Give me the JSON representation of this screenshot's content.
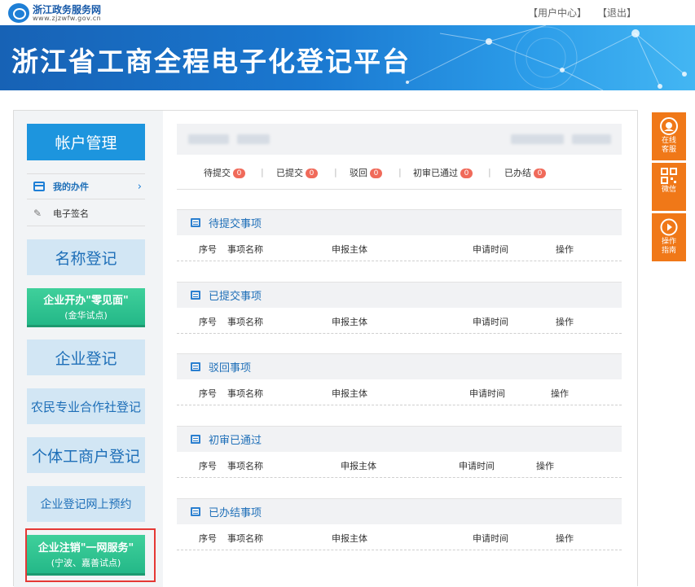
{
  "header": {
    "logo_cn": "浙江政务服务网",
    "logo_en": "www.zjzwfw.gov.cn",
    "user_center": "【用户中心】",
    "logout": "【退出】"
  },
  "banner": {
    "title": "浙江省工商全程电子化登记平台"
  },
  "sidebar": {
    "account_title": "帐户管理",
    "account_items": [
      {
        "label": "我的办件"
      },
      {
        "label": "电子签名"
      }
    ],
    "nav": [
      {
        "label": "名称登记"
      },
      {
        "line1": "企业开办\"零见面\"",
        "line2": "(金华试点)"
      },
      {
        "label": "企业登记"
      },
      {
        "label": "农民专业合作社登记"
      },
      {
        "label": "个体工商户登记"
      },
      {
        "label": "企业登记网上预约"
      },
      {
        "line1": "企业注销\"一网服务\"",
        "line2": "(宁波、嘉善试点)"
      }
    ]
  },
  "stats": [
    {
      "label": "待提交",
      "count": "0"
    },
    {
      "label": "已提交",
      "count": "0"
    },
    {
      "label": "驳回",
      "count": "0"
    },
    {
      "label": "初审已通过",
      "count": "0"
    },
    {
      "label": "已办结",
      "count": "0"
    }
  ],
  "sections": [
    {
      "title": "待提交事项",
      "cols": [
        "序号",
        "事项名称",
        "申报主体",
        "申请时间",
        "操作"
      ]
    },
    {
      "title": "已提交事项",
      "cols": [
        "序号",
        "事项名称",
        "申报主体",
        "申请时间",
        "操作"
      ]
    },
    {
      "title": "驳回事项",
      "cols": [
        "序号",
        "事项名称",
        "申报主体",
        "申请时间",
        "操作"
      ]
    },
    {
      "title": "初审已通过",
      "cols": [
        "序号",
        "事项名称",
        "申报主体",
        "申请时间",
        "操作"
      ]
    },
    {
      "title": "已办结事项",
      "cols": [
        "序号",
        "事项名称",
        "申报主体",
        "申请时间",
        "操作"
      ]
    }
  ],
  "rightbar": [
    {
      "line1": "在线",
      "line2": "客服",
      "icon": "headset-icon"
    },
    {
      "line1": "微信",
      "line2": "",
      "icon": "qrcode-icon"
    },
    {
      "line1": "操作",
      "line2": "指南",
      "icon": "play-circle-icon"
    }
  ],
  "colors": {
    "accent": "#1d95de",
    "banner": "#1a78d0",
    "badge": "#f06a5a",
    "green": "#24b888",
    "orange": "#f07818",
    "highlight": "#e53935"
  }
}
